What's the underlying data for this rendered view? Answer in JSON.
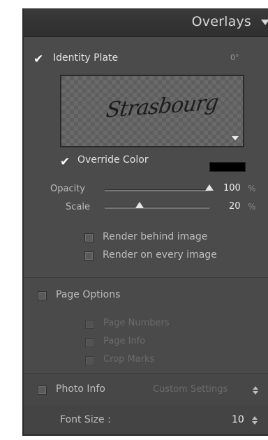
{
  "panel": {
    "title": "Overlays",
    "collapse_icon": "triangle-down-icon"
  },
  "identity_plate": {
    "label": "Identity Plate",
    "checked": true,
    "angle": "0°",
    "signature_text": "Strasbourg",
    "menu_icon": "triangle-down-icon"
  },
  "override_color": {
    "label": "Override Color",
    "checked": true,
    "color": "#000000"
  },
  "opacity": {
    "label": "Opacity",
    "value": "100",
    "unit": "%",
    "level": 1.0
  },
  "scale": {
    "label": "Scale",
    "value": "20",
    "unit": "%",
    "level": 0.2
  },
  "render_behind": {
    "label": "Render behind image",
    "checked": false
  },
  "render_every": {
    "label": "Render on every image",
    "checked": false
  },
  "page_options": {
    "label": "Page Options",
    "checked": false,
    "items": [
      {
        "label": "Page Numbers",
        "checked": false
      },
      {
        "label": "Page Info",
        "checked": false
      },
      {
        "label": "Crop Marks",
        "checked": false
      }
    ]
  },
  "photo_info": {
    "label": "Photo Info",
    "checked": false,
    "setting": "Custom Settings",
    "setting_icon": "up-down-arrows-icon"
  },
  "font_size": {
    "label": "Font Size :",
    "value": "10",
    "stepper_icon": "up-down-stepper-icon"
  }
}
